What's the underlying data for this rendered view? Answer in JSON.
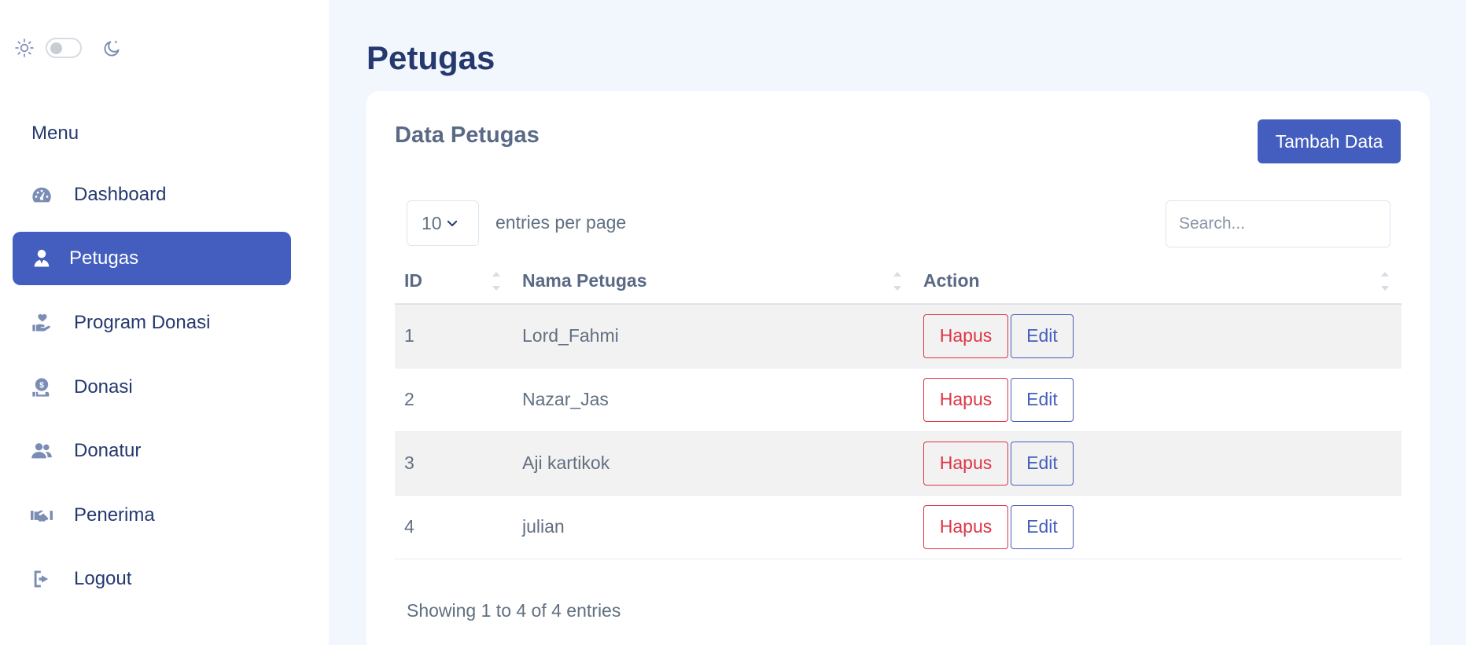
{
  "sidebar": {
    "menu_title": "Menu",
    "items": [
      {
        "label": "Dashboard",
        "icon": "dashboard-gauge-icon"
      },
      {
        "label": "Petugas",
        "icon": "user-tie-icon",
        "active": true
      },
      {
        "label": "Program Donasi",
        "icon": "hand-heart-icon"
      },
      {
        "label": "Donasi",
        "icon": "money-hand-icon"
      },
      {
        "label": "Donatur",
        "icon": "users-icon"
      },
      {
        "label": "Penerima",
        "icon": "handshake-icon"
      },
      {
        "label": "Logout",
        "icon": "logout-icon"
      }
    ]
  },
  "theme": {
    "light_icon": "sun-icon",
    "dark_icon": "moon-icon",
    "dark_mode": false
  },
  "page": {
    "title": "Petugas"
  },
  "card": {
    "title": "Data Petugas",
    "add_button": "Tambah Data",
    "per_page_value": "10",
    "per_page_label": "entries per page",
    "search_placeholder": "Search...",
    "columns": [
      "ID",
      "Nama Petugas",
      "Action"
    ],
    "rows": [
      {
        "id": "1",
        "name": "Lord_Fahmi"
      },
      {
        "id": "2",
        "name": "Nazar_Jas"
      },
      {
        "id": "3",
        "name": "Aji kartikok"
      },
      {
        "id": "4",
        "name": "julian"
      }
    ],
    "delete_label": "Hapus",
    "edit_label": "Edit",
    "info": "Showing 1 to 4 of 4 entries"
  },
  "colors": {
    "primary": "#435ebe",
    "danger": "#dc3545",
    "text": "#25396f",
    "background": "#f2f6fd"
  }
}
